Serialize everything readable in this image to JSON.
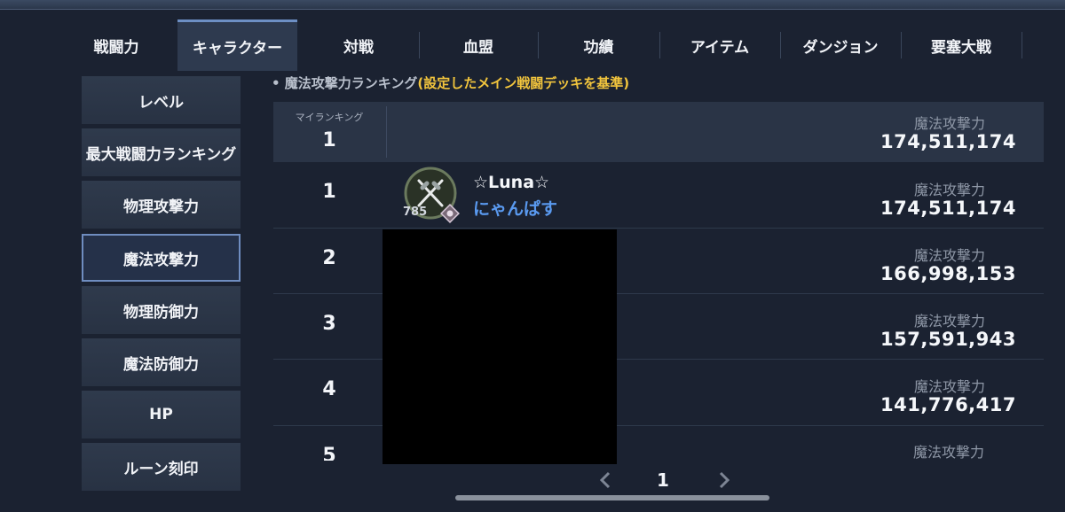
{
  "tabs": [
    "戦闘力",
    "キャラクター",
    "対戦",
    "血盟",
    "功績",
    "アイテム",
    "ダンジョン",
    "要塞大戦"
  ],
  "active_tab": "キャラクター",
  "sidebar": [
    "レベル",
    "最大戦闘力ランキング",
    "物理攻撃力",
    "魔法攻撃力",
    "物理防御力",
    "魔法防御力",
    "HP",
    "ルーン刻印"
  ],
  "active_sidebar": "魔法攻撃力",
  "section": {
    "title_prefix": "• 魔法攻撃力ランキング",
    "title_highlight": "(設定したメイン戦闘デッキを基準)"
  },
  "my_rank": {
    "label": "マイランキング",
    "rank": "1",
    "stat_label": "魔法攻撃力",
    "stat_value": "174,511,174"
  },
  "rows": [
    {
      "rank": "1",
      "name": "☆Luna☆",
      "guild": "にゃんぱす",
      "level": "785",
      "stat_label": "魔法攻撃力",
      "stat_value": "174,511,174"
    },
    {
      "rank": "2",
      "stat_label": "魔法攻撃力",
      "stat_value": "166,998,153"
    },
    {
      "rank": "3",
      "stat_label": "魔法攻撃力",
      "stat_value": "157,591,943"
    },
    {
      "rank": "4",
      "stat_label": "魔法攻撃力",
      "stat_value": "141,776,417"
    },
    {
      "rank": "5",
      "stat_label": "魔法攻撃力"
    }
  ],
  "pagination": {
    "page": "1",
    "prev_icon": "chevron-left-icon",
    "next_icon": "chevron-right-icon"
  },
  "colors": {
    "accent": "#6d8fc4",
    "highlight": "#f2c53d",
    "guild": "#5a9af0",
    "background": "#1b2231"
  }
}
